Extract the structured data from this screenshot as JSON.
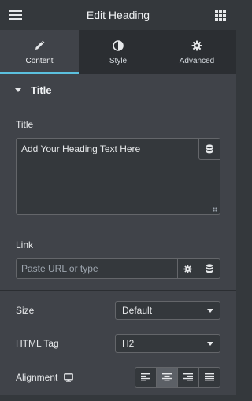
{
  "header": {
    "title": "Edit Heading",
    "menu_icon": "hamburger-icon",
    "apps_icon": "grid-icon"
  },
  "tabs": [
    {
      "label": "Content",
      "icon": "pencil-icon",
      "active": true
    },
    {
      "label": "Style",
      "icon": "half-circle-icon",
      "active": false
    },
    {
      "label": "Advanced",
      "icon": "gear-icon",
      "active": false
    }
  ],
  "section": {
    "title": "Title"
  },
  "title_control": {
    "label": "Title",
    "value": "Add Your Heading Text Here"
  },
  "link_control": {
    "label": "Link",
    "placeholder": "Paste URL or type"
  },
  "size_control": {
    "label": "Size",
    "value": "Default"
  },
  "html_tag_control": {
    "label": "HTML Tag",
    "value": "H2"
  },
  "alignment_control": {
    "label": "Alignment",
    "options": [
      "left",
      "center",
      "right",
      "justify"
    ],
    "selected": "center"
  },
  "colors": {
    "accent": "#5bc0de",
    "panel": "#404349",
    "background": "#34383c"
  }
}
